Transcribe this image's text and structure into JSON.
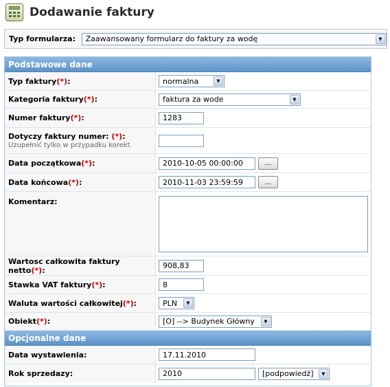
{
  "page": {
    "title": "Dodawanie faktury",
    "icon": "calculator-icon"
  },
  "form_type": {
    "label": "Typ formularza:",
    "selected": "Zaawansowany formularz do faktury za wodę"
  },
  "required_mark": "(*)",
  "sections": {
    "basic": "Podstawowe dane",
    "optional": "Opcjonalne dane"
  },
  "fields": {
    "typ_faktury": {
      "label": "Typ faktury",
      "value": "normalna"
    },
    "kategoria": {
      "label": "Kategoria faktury",
      "value": "faktura za wode"
    },
    "numer": {
      "label": "Numer faktury",
      "value": "1283"
    },
    "dotyczy": {
      "label": "Dotyczy faktury numer: ",
      "hint": "Uzupełnić tylko w przypadku korekt",
      "value": ""
    },
    "data_poczatkowa": {
      "label": "Data początkowa",
      "value": "2010-10-05 00:00:00",
      "button": "..."
    },
    "data_koncowa": {
      "label": "Data końcowa",
      "value": "2010-11-03 23:59:59",
      "button": "..."
    },
    "komentarz": {
      "label": "Komentarz:",
      "value": ""
    },
    "wartosc": {
      "label": "Wartosc całkowita faktury netto",
      "value": "908,83"
    },
    "stawka_vat": {
      "label": "Stawka VAT faktury",
      "value": "8"
    },
    "waluta": {
      "label": "Waluta wartości całkowitej",
      "value": "PLN"
    },
    "obiekt": {
      "label": "Obiekt",
      "value": "[O] --> Budynek Główny"
    },
    "data_wystawienia": {
      "label": "Data wystawienia:",
      "value": "17.11.2010"
    },
    "rok_sprzedazy": {
      "label": "Rok sprzedazy:",
      "value": "2010",
      "hint_select": "[podpowiedź]"
    }
  },
  "colors": {
    "section_header": "#6a9fd2",
    "required": "#cc0000",
    "input_border": "#7f9db9"
  }
}
